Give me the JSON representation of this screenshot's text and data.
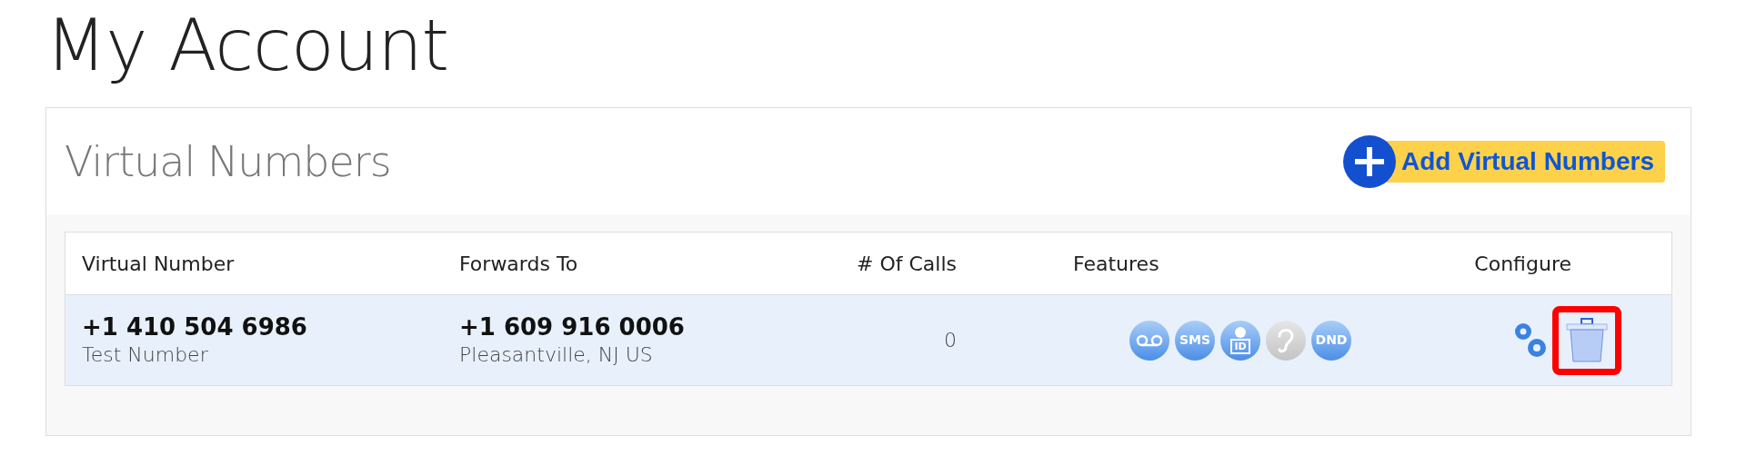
{
  "page_title": "My Account",
  "panel": {
    "title": "Virtual Numbers",
    "add_button": "Add Virtual Numbers"
  },
  "table": {
    "columns": [
      "Virtual Number",
      "Forwards To",
      "# Of Calls",
      "Features",
      "Configure"
    ],
    "rows": [
      {
        "number": "+1 410 504 6986",
        "name": "Test Number",
        "forward_number": "+1 609 916 0006",
        "forward_location": "Pleasantville, NJ US",
        "calls": "0",
        "features": [
          {
            "kind": "voicemail",
            "enabled": true
          },
          {
            "kind": "text",
            "label": "SMS",
            "enabled": true
          },
          {
            "kind": "id",
            "label": "ID",
            "enabled": true
          },
          {
            "kind": "ear",
            "enabled": false
          },
          {
            "kind": "text",
            "label": "DND",
            "enabled": true
          }
        ],
        "delete_highlighted": true
      }
    ]
  }
}
